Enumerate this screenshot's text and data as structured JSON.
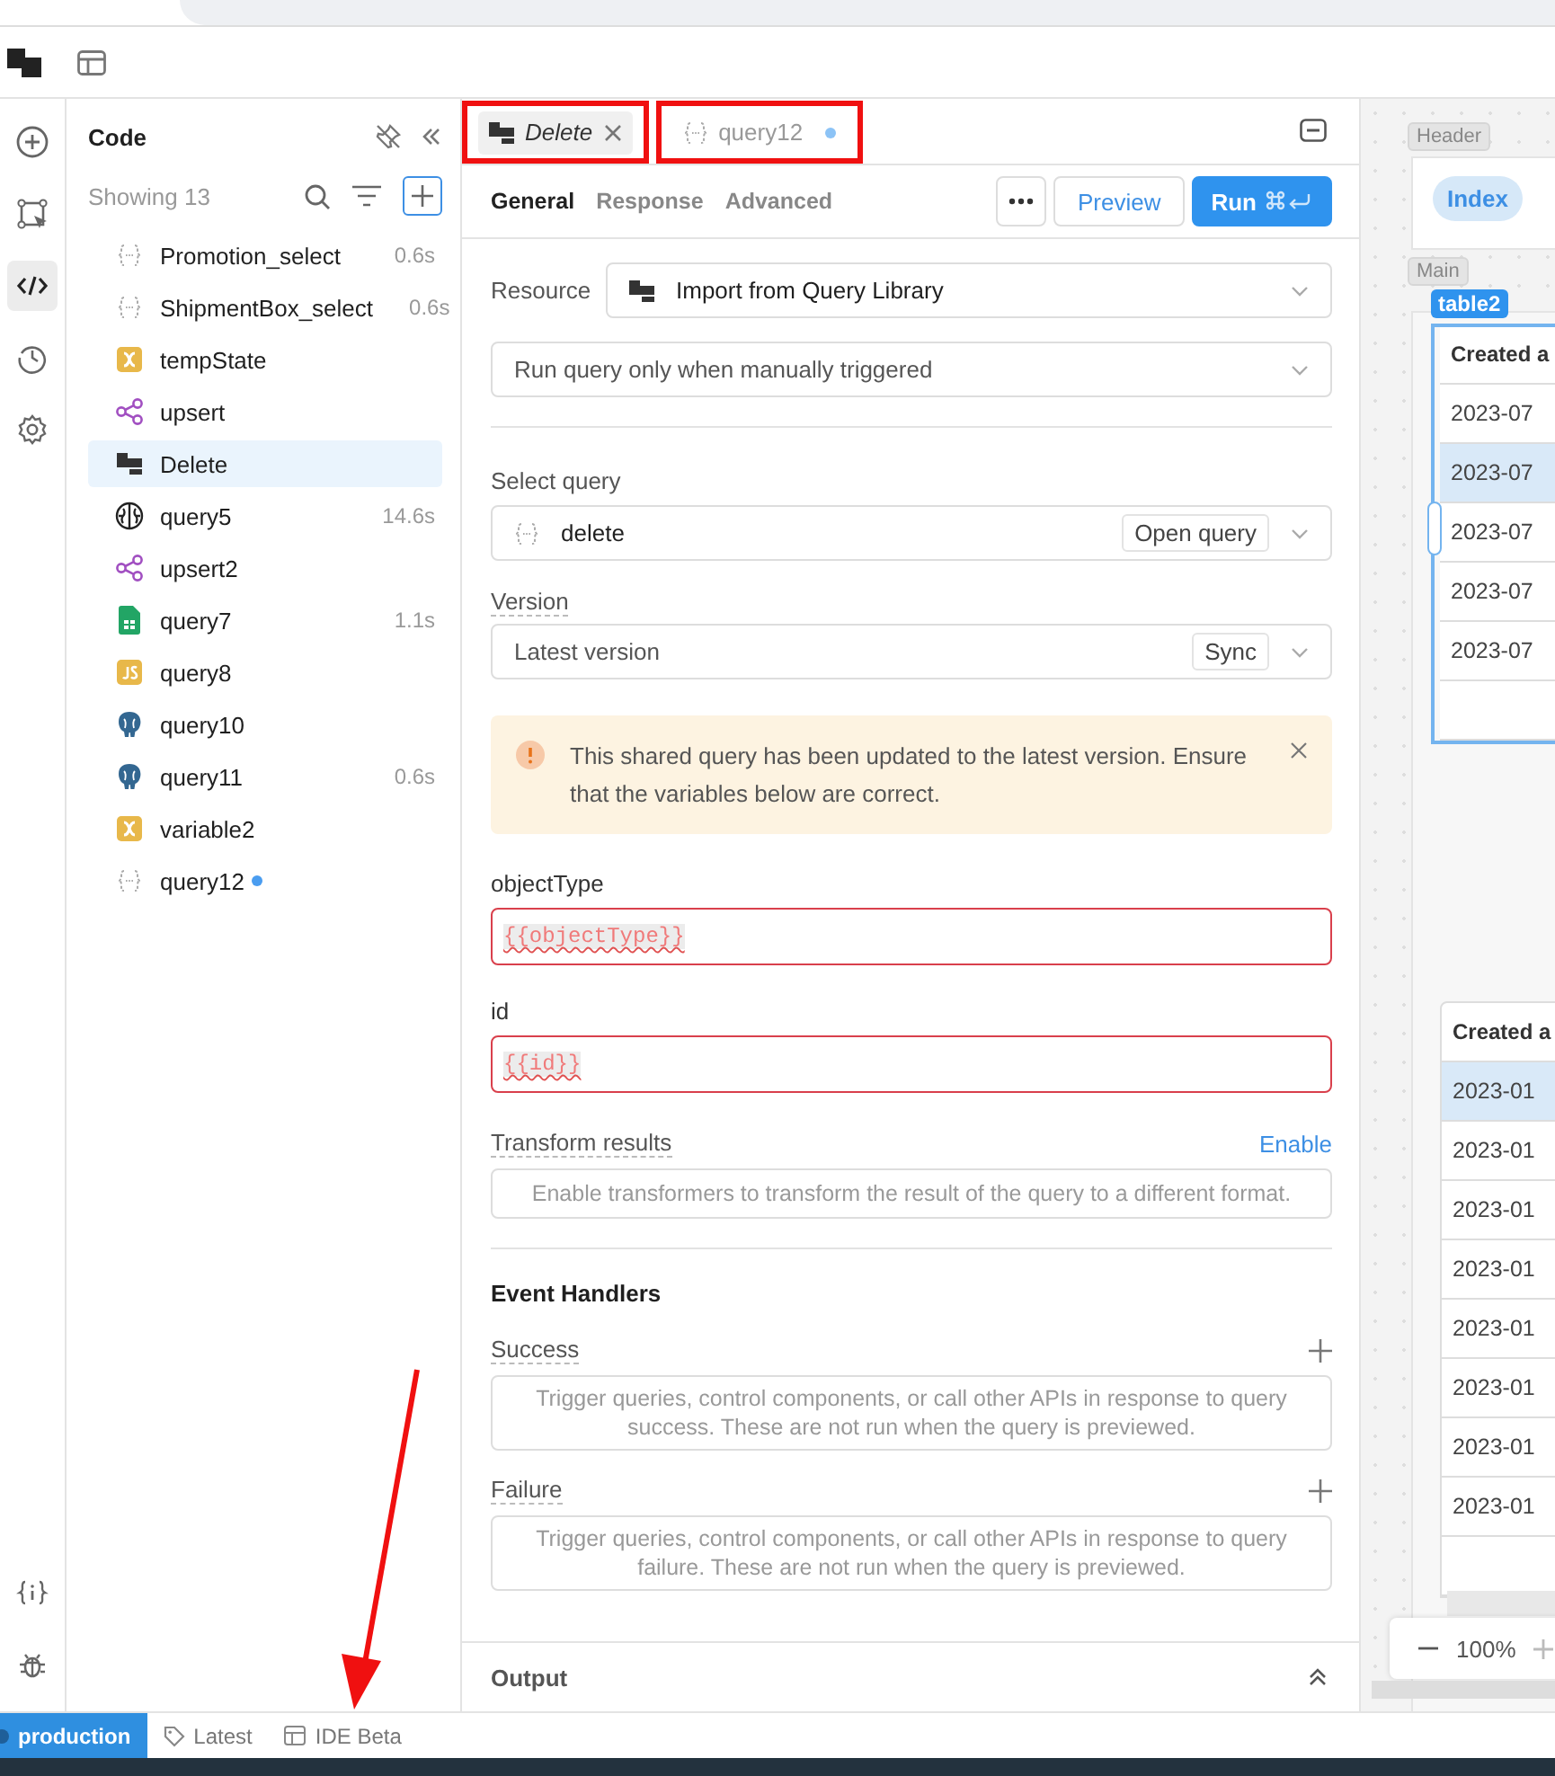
{
  "rail": {
    "items": [
      {
        "kind": "add",
        "selected": false
      },
      {
        "kind": "components",
        "selected": false
      },
      {
        "kind": "code",
        "selected": true
      },
      {
        "kind": "history",
        "selected": false
      },
      {
        "kind": "settings",
        "selected": false
      },
      {
        "kind": "state",
        "selected": false
      },
      {
        "kind": "debug",
        "selected": false
      }
    ]
  },
  "code_panel": {
    "title": "Code",
    "count": "Showing 13",
    "items": [
      {
        "name": "Promotion_select",
        "kind": "query",
        "time": "0.6s",
        "selected": false,
        "unsaved": false
      },
      {
        "name": "ShipmentBox_select",
        "kind": "query",
        "time": "0.6s",
        "selected": false,
        "unsaved": false
      },
      {
        "name": "tempState",
        "kind": "variable",
        "selected": false,
        "unsaved": false
      },
      {
        "name": "upsert",
        "kind": "workflow",
        "selected": false,
        "unsaved": false
      },
      {
        "name": "Delete",
        "kind": "library",
        "selected": true,
        "unsaved": false
      },
      {
        "name": "query5",
        "kind": "ai",
        "time": "14.6s",
        "selected": false,
        "unsaved": false
      },
      {
        "name": "upsert2",
        "kind": "workflow",
        "selected": false,
        "unsaved": false
      },
      {
        "name": "query7",
        "kind": "sheet",
        "time": "1.1s",
        "selected": false,
        "unsaved": false
      },
      {
        "name": "query8",
        "kind": "js",
        "selected": false,
        "unsaved": false
      },
      {
        "name": "query10",
        "kind": "postgres",
        "selected": false,
        "unsaved": false
      },
      {
        "name": "query11",
        "kind": "postgres",
        "time": "0.6s",
        "selected": false,
        "unsaved": false
      },
      {
        "name": "variable2",
        "kind": "variable",
        "selected": false,
        "unsaved": false
      },
      {
        "name": "query12",
        "kind": "query",
        "selected": false,
        "unsaved": true
      }
    ]
  },
  "editor": {
    "tabs": [
      {
        "label": "Delete",
        "kind": "library",
        "selected": true,
        "highlighted": true
      },
      {
        "label": "query12",
        "kind": "query",
        "selected": false,
        "unsaved": true,
        "highlighted": true
      }
    ],
    "subtabs": [
      {
        "label": "General",
        "selected": true
      },
      {
        "label": "Response",
        "selected": false
      },
      {
        "label": "Advanced",
        "selected": false
      }
    ],
    "preview": "Preview",
    "run": "Run",
    "resource_label": "Resource",
    "resource": "Import from Query Library",
    "trigger": "Run query only when manually triggered",
    "select_query_label": "Select query",
    "select_query": "delete",
    "open_query": "Open query",
    "version_label": "Version",
    "version": "Latest version",
    "sync": "Sync",
    "alert": "This shared query has been updated to the latest version. Ensure that the variables below are correct.",
    "params": [
      {
        "label": "objectType",
        "value": "{{objectType}}",
        "error": true
      },
      {
        "label": "id",
        "value": "{{id}}",
        "error": true
      }
    ],
    "transform": {
      "label": "Transform results",
      "action": "Enable",
      "placeholder": "Enable transformers to transform the result of the query to a different format."
    },
    "event_handlers": {
      "title": "Event Handlers",
      "groups": [
        {
          "label": "Success",
          "hint": "Trigger queries, control components, or call other APIs in response to query success. These are not run when the query is previewed."
        },
        {
          "label": "Failure",
          "hint": "Trigger queries, control components, or call other APIs in response to query failure. These are not run when the query is previewed."
        }
      ]
    },
    "output": "Output"
  },
  "canvas": {
    "header_label": "Header",
    "nav_button": "Index",
    "main_label": "Main",
    "selected_component": "table2",
    "tables": [
      {
        "column_1": "Created a",
        "rows": [
          {
            "cell": "2023-07",
            "selected": false
          },
          {
            "cell": "2023-07",
            "selected": true
          },
          {
            "cell": "2023-07",
            "selected": false
          },
          {
            "cell": "2023-07",
            "selected": false
          },
          {
            "cell": "2023-07",
            "selected": false
          }
        ]
      },
      {
        "column_1": "Created a",
        "rows": [
          {
            "cell": "2023-01",
            "selected": true
          },
          {
            "cell": "2023-01",
            "selected": false
          },
          {
            "cell": "2023-01",
            "selected": false
          },
          {
            "cell": "2023-01",
            "selected": false
          },
          {
            "cell": "2023-01",
            "selected": false
          },
          {
            "cell": "2023-01",
            "selected": false
          },
          {
            "cell": "2023-01",
            "selected": false
          },
          {
            "cell": "2023-01",
            "selected": false
          }
        ]
      }
    ],
    "zoom": "100%"
  },
  "status": {
    "items": [
      {
        "label": "production",
        "kind": "env"
      },
      {
        "label": "Latest",
        "kind": "tag"
      },
      {
        "label": "IDE Beta",
        "kind": "ide"
      }
    ]
  },
  "annotations": [
    {
      "kind": "arrow"
    }
  ]
}
